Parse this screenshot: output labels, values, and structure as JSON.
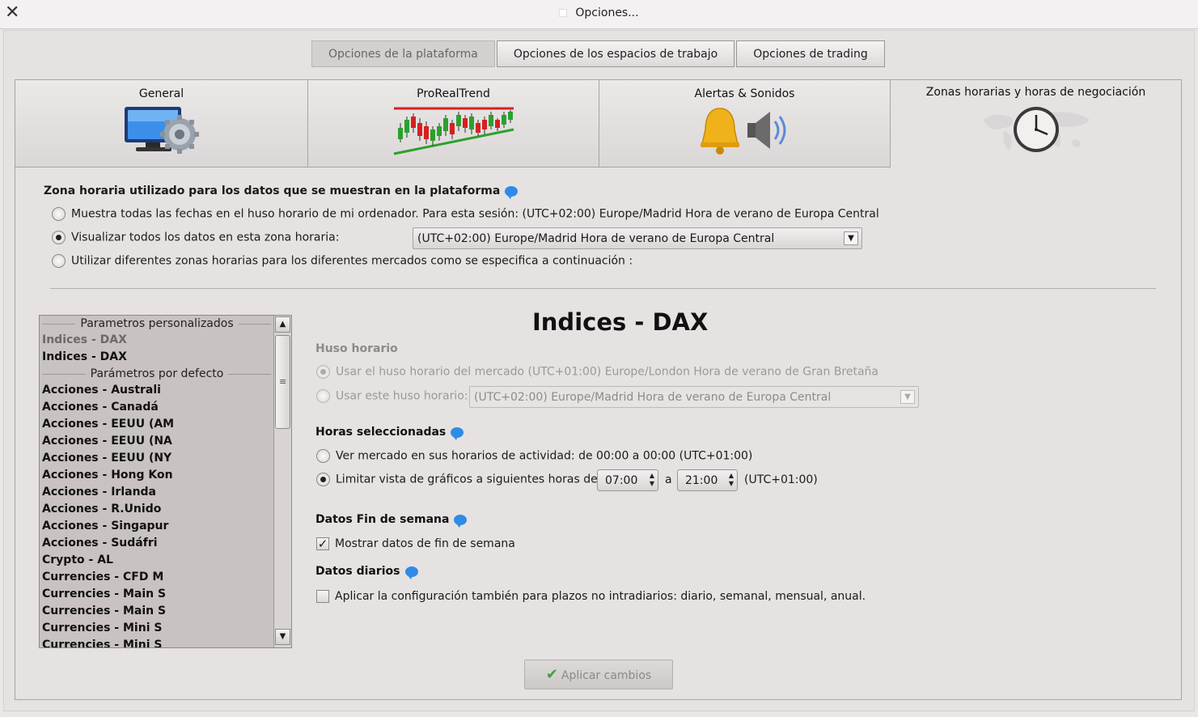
{
  "window": {
    "title": "Opciones...",
    "close_glyph": "✕"
  },
  "top_tabs": [
    {
      "label": "Opciones de la plataforma",
      "active": true
    },
    {
      "label": "Opciones de los espacios de trabajo",
      "active": false
    },
    {
      "label": "Opciones de trading",
      "active": false
    }
  ],
  "category_tabs": [
    {
      "label": "General",
      "icon": "computer-gear-icon"
    },
    {
      "label": "ProRealTrend",
      "icon": "candlestick-trend-icon"
    },
    {
      "label": "Alertas & Sonidos",
      "icon": "bell-speaker-icon"
    },
    {
      "label": "Zonas horarias y horas de negociación",
      "icon": "world-clock-icon",
      "active": true
    }
  ],
  "timezone": {
    "heading": "Zona horaria utilizado para los datos que se muestran en la plataforma",
    "opt1": "Muestra todas las fechas en el huso horario de mi ordenador. Para esta sesión: (UTC+02:00) Europe/Madrid Hora de verano de Europa Central",
    "opt2": "Visualizar todos los datos en esta zona horaria:",
    "opt2_value": "(UTC+02:00) Europe/Madrid Hora de verano de Europa Central",
    "opt3": "Utilizar diferentes zonas horarias para los diferentes mercados como se especifica a continuación :",
    "selected": 2
  },
  "market_list": {
    "custom_header": "Parametros personalizados",
    "custom_items": [
      "Indices - DAX",
      "Indices - DAX"
    ],
    "default_header": "Parámetros por defecto",
    "default_items": [
      "Acciones - Australi",
      "Acciones - Canadá",
      "Acciones - EEUU (AM",
      "Acciones - EEUU (NA",
      "Acciones - EEUU (NY",
      "Acciones - Hong Kon",
      "Acciones - Irlanda",
      "Acciones - R.Unido",
      "Acciones - Singapur",
      "Acciones - Sudáfri",
      "Crypto - AL",
      "Currencies - CFD M",
      "Currencies - Main S",
      "Currencies - Main S",
      "Currencies - Mini S",
      "Currencies - Mini S"
    ]
  },
  "market": {
    "title": "Indices - DAX",
    "huso_heading": "Huso horario",
    "huso_opt1": "Usar el huso horario del mercado (UTC+01:00) Europe/London Hora de verano de Gran Bretaña",
    "huso_opt2": "Usar este huso horario:",
    "huso_opt2_value": "(UTC+02:00) Europe/Madrid Hora de verano de Europa Central",
    "horas_heading": "Horas seleccionadas",
    "horas_opt1": "Ver mercado en sus horarios de actividad: de 00:00 a 00:00  (UTC+01:00)",
    "horas_opt2": "Limitar vista de gráficos a siguientes horas   de",
    "hora_desde": "07:00",
    "hora_sep": "a",
    "hora_hasta": "21:00",
    "hora_tz": "(UTC+01:00)",
    "fin_semana_heading": "Datos Fin de semana",
    "fin_semana_check": "Mostrar datos de fin de semana",
    "fin_semana_checked": true,
    "diarios_heading": "Datos diarios",
    "diarios_check": "Aplicar la configuración también para plazos no intradiarios: diario, semanal, mensual, anual.",
    "diarios_checked": false
  },
  "apply_button": "Aplicar cambios",
  "colors": {
    "info_bubble": "#2f8be8",
    "trend_red": "#d62020",
    "trend_green": "#2ca02c"
  }
}
